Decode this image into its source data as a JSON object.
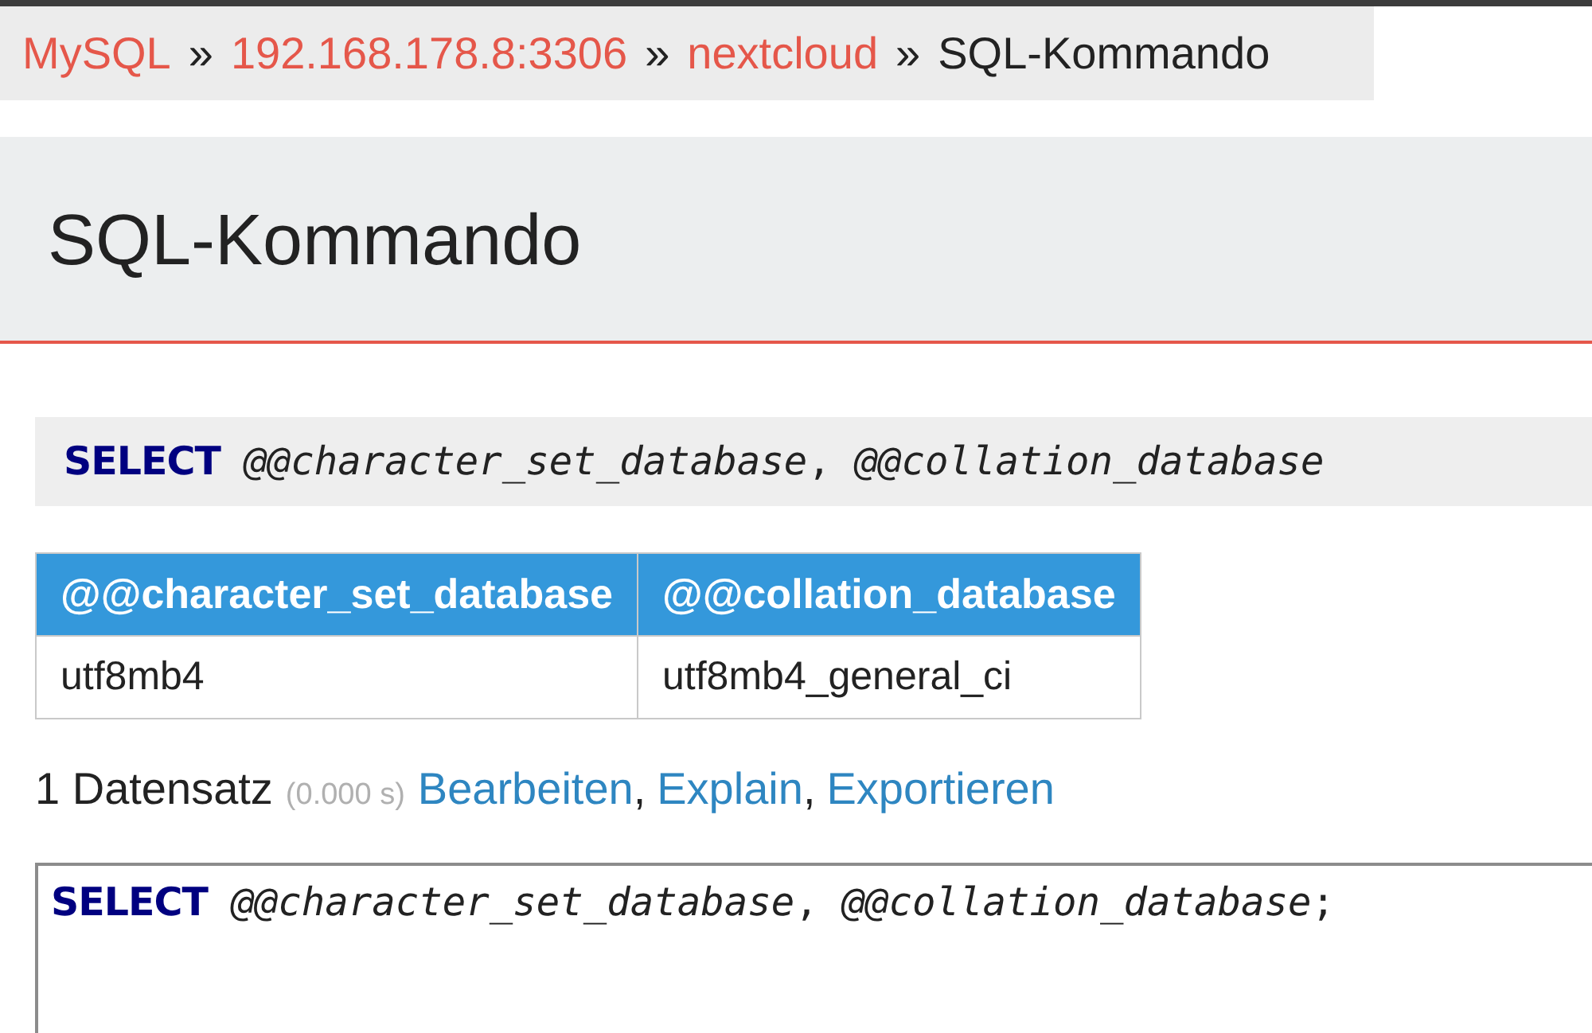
{
  "breadcrumb": [
    {
      "label": "MySQL",
      "link": true,
      "separator": "»"
    },
    {
      "label": "192.168.178.8:3306",
      "link": true,
      "separator": "»"
    },
    {
      "label": "nextcloud",
      "link": true,
      "separator": "»"
    },
    {
      "label": "SQL-Kommando",
      "link": false
    }
  ],
  "page_title": "SQL-Kommando",
  "query": [
    {
      "text": "SELECT",
      "kind": "keyword"
    },
    {
      "text": " @@character_set_database",
      "kind": "variable"
    },
    {
      "text": ",",
      "kind": "punct"
    },
    {
      "text": " @@collation_database",
      "kind": "variable"
    }
  ],
  "table": {
    "columns": [
      "@@character_set_database",
      "@@collation_database"
    ],
    "rows": [
      [
        "utf8mb4",
        "utf8mb4_general_ci"
      ]
    ]
  },
  "result": {
    "count": "1 Datensatz",
    "time": "(0.000 s)",
    "links": [
      {
        "label": "Bearbeiten",
        "separator": ","
      },
      {
        "label": "Explain",
        "separator": ","
      },
      {
        "label": "Exportieren"
      }
    ]
  },
  "editor": {
    "tokens": [
      {
        "text": "SELECT",
        "kind": "keyword"
      },
      {
        "text": " @@character_set_database",
        "kind": "variable"
      },
      {
        "text": ",",
        "kind": "punct"
      },
      {
        "text": " @@collation_database",
        "kind": "variable"
      },
      {
        "text": ";",
        "kind": "punct"
      }
    ]
  }
}
